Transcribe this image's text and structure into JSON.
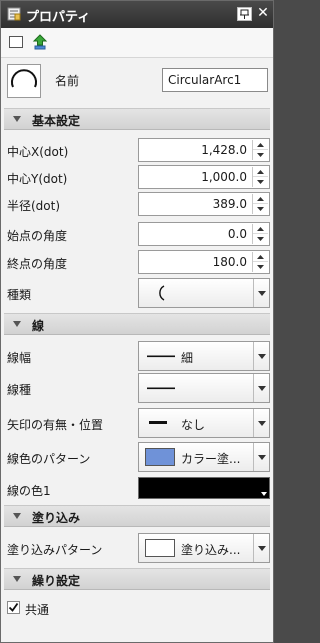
{
  "window": {
    "title": "プロパティ",
    "title_icon": "properties-icon",
    "pin_icon": "pin-icon",
    "close_icon": "close-icon"
  },
  "toolbar": {
    "icons": [
      "new-blank-icon",
      "up-arrow-icon"
    ]
  },
  "name_row": {
    "label": "名前",
    "value": "CircularArc1",
    "preview_icon": "arc-preview-icon"
  },
  "sections": {
    "basic": "基本設定",
    "line": "線",
    "fill": "塗り込み",
    "repeat": "繰り設定"
  },
  "basic": {
    "center_x": {
      "label": "中心X(dot)",
      "value": "1,428.0"
    },
    "center_y": {
      "label": "中心Y(dot)",
      "value": "1,000.0"
    },
    "radius": {
      "label": "半径(dot)",
      "value": "389.0"
    },
    "start_angle": {
      "label": "始点の角度",
      "value": "0.0"
    },
    "end_angle": {
      "label": "終点の角度",
      "value": "180.0"
    },
    "kind": {
      "label": "種類",
      "icon": "arc-kind-icon"
    }
  },
  "line": {
    "width": {
      "label": "線幅",
      "value": "細"
    },
    "style": {
      "label": "線種"
    },
    "arrow": {
      "label": "矢印の有無・位置",
      "value": "なし"
    },
    "pattern": {
      "label": "線色のパターン",
      "value": "カラー塗...",
      "swatch": "#6f92d8"
    },
    "color1": {
      "label": "線の色1",
      "color": "#000000"
    }
  },
  "fill": {
    "pattern": {
      "label": "塗り込みパターン",
      "value": "塗り込み...",
      "swatch": "#ffffff"
    }
  },
  "repeat": {
    "common": {
      "label": "共通",
      "checked": true
    }
  }
}
